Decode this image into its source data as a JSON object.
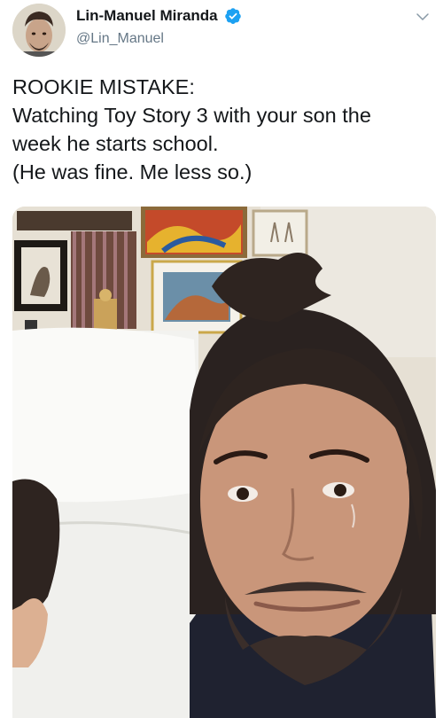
{
  "user": {
    "display_name": "Lin-Manuel Miranda",
    "handle": "@Lin_Manuel",
    "verified": true,
    "avatar_icon": "avatar-photo"
  },
  "menu_icon": "chevron-down-icon",
  "tweet": {
    "lines": [
      "ROOKIE MISTAKE:",
      "Watching Toy Story 3 with your son the",
      "week he starts school.",
      "(He was fine. Me less so.)"
    ]
  },
  "media": {
    "type": "photo",
    "description_icon": "selfie-photo"
  },
  "colors": {
    "verified_blue": "#1da1f2",
    "text": "#14171a",
    "secondary": "#657786"
  }
}
